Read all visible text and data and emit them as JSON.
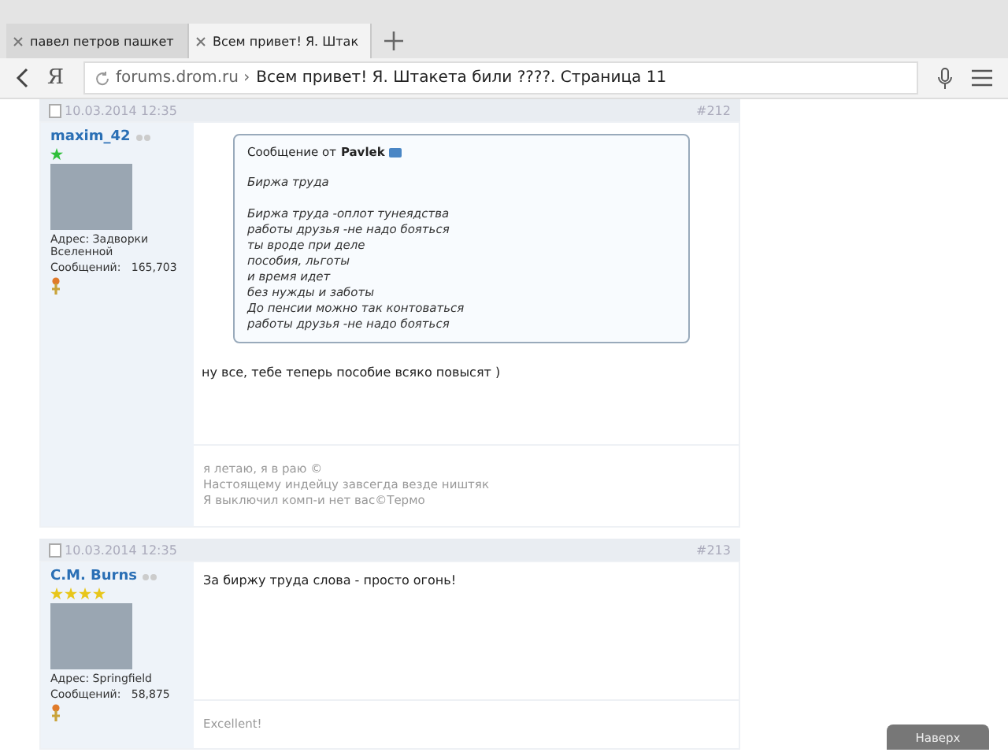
{
  "tabs": [
    {
      "label": "павел петров пашкет",
      "selected": false
    },
    {
      "label": "Всем привет! Я. Штак",
      "selected": true
    }
  ],
  "address_bar": {
    "logo": "Я",
    "domain": "forums.drom.ru",
    "separator": "›",
    "page_title": "Всем привет! Я. Штакета били ????. Страница 11"
  },
  "posts": [
    {
      "date": "10.03.2014 12:35",
      "number": "#212",
      "author": "maxim_42",
      "rank_stars": [
        {
          "color": "#2fbf3a"
        }
      ],
      "address": "Адрес: Задворки Вселенной",
      "posts_label": "Сообщений:",
      "posts_count": "165,703",
      "quote": {
        "header": "Сообщение от",
        "author": "Pavlek",
        "title": "Биржа труда",
        "lines": [
          "Биржа труда -оплот тунеядства",
          "работы друзья -не надо бояться",
          "ты вроде при деле",
          "пособия, льготы",
          "и время идет",
          "без нужды и заботы",
          "До пенсии можно так контоваться",
          "работы друзья -не надо бояться"
        ]
      },
      "message": "ну все, тебе теперь пособие всяко повысят )",
      "signature": [
        "я летаю, я в раю ©",
        "Настоящему индейцу завсегда везде ништяк",
        "Я выключил комп-и нет вас©Термо"
      ]
    },
    {
      "date": "10.03.2014 12:35",
      "number": "#213",
      "author": "C.M. Burns",
      "rank_stars": [
        {
          "color": "#e8c619"
        },
        {
          "color": "#e8c619"
        },
        {
          "color": "#e8c619"
        },
        {
          "color": "#e8c619"
        }
      ],
      "address": "Адрес: Springfield",
      "posts_label": "Сообщений:",
      "posts_count": "58,875",
      "message": "За биржу труда слова - просто огонь!",
      "signature": [
        "Excellent!"
      ]
    }
  ],
  "scroll_top_button": "Наверх"
}
